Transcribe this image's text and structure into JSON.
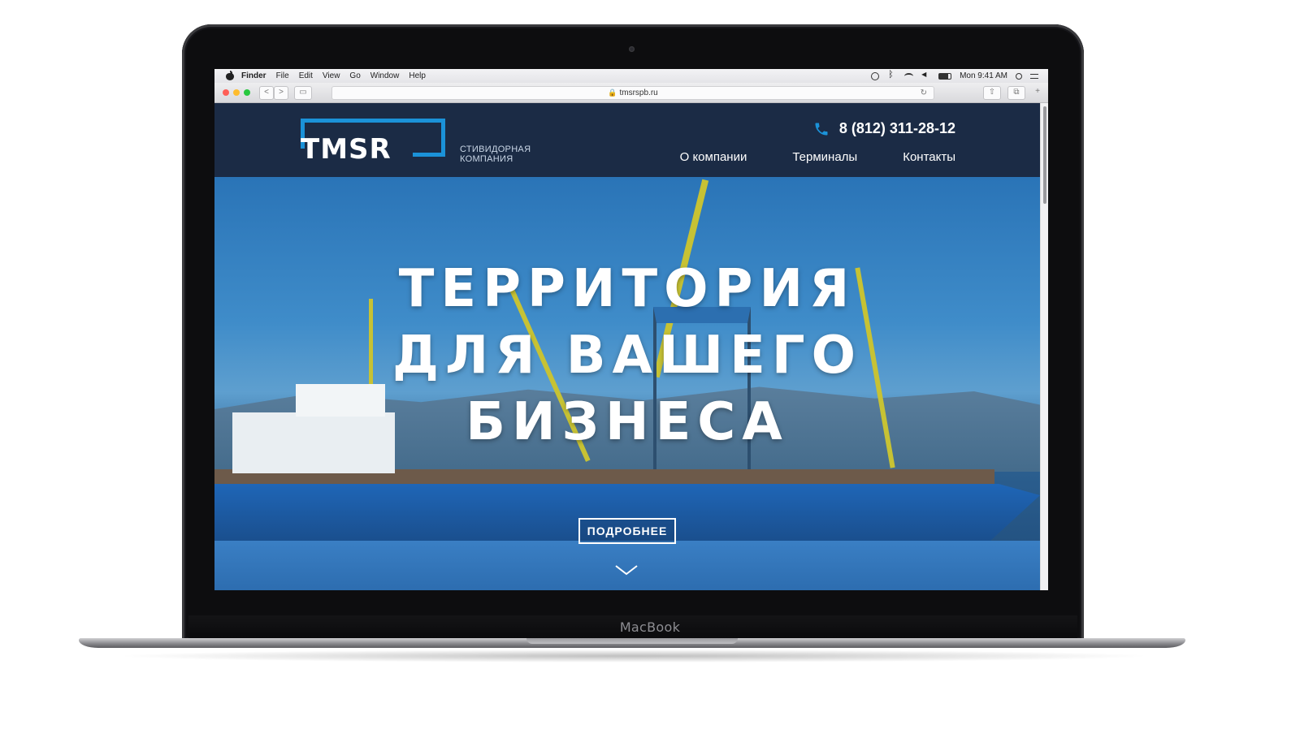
{
  "os_menubar": {
    "app_name": "Finder",
    "menus": [
      "File",
      "Edit",
      "View",
      "Go",
      "Window",
      "Help"
    ],
    "clock": "Mon 9:41 AM"
  },
  "browser": {
    "url": "tmsrspb.ru",
    "back_label": "<",
    "forward_label": ">"
  },
  "site": {
    "logo_text": "TMSR",
    "logo_subtitle_line1": "СТИВИДОРНАЯ",
    "logo_subtitle_line2": "КОМПАНИЯ",
    "phone": "8 (812) 311-28-12",
    "nav": [
      "О компании",
      "Терминалы",
      "Контакты"
    ],
    "hero_title_lines": [
      "ТЕРРИТОРИЯ",
      "ДЛЯ ВАШЕГО",
      "БИЗНЕСА"
    ],
    "cta_label": "ПОДРОБНЕЕ"
  },
  "device": {
    "label": "MacBook"
  },
  "colors": {
    "header_bg": "#1b2b45",
    "accent": "#1b92d8"
  }
}
